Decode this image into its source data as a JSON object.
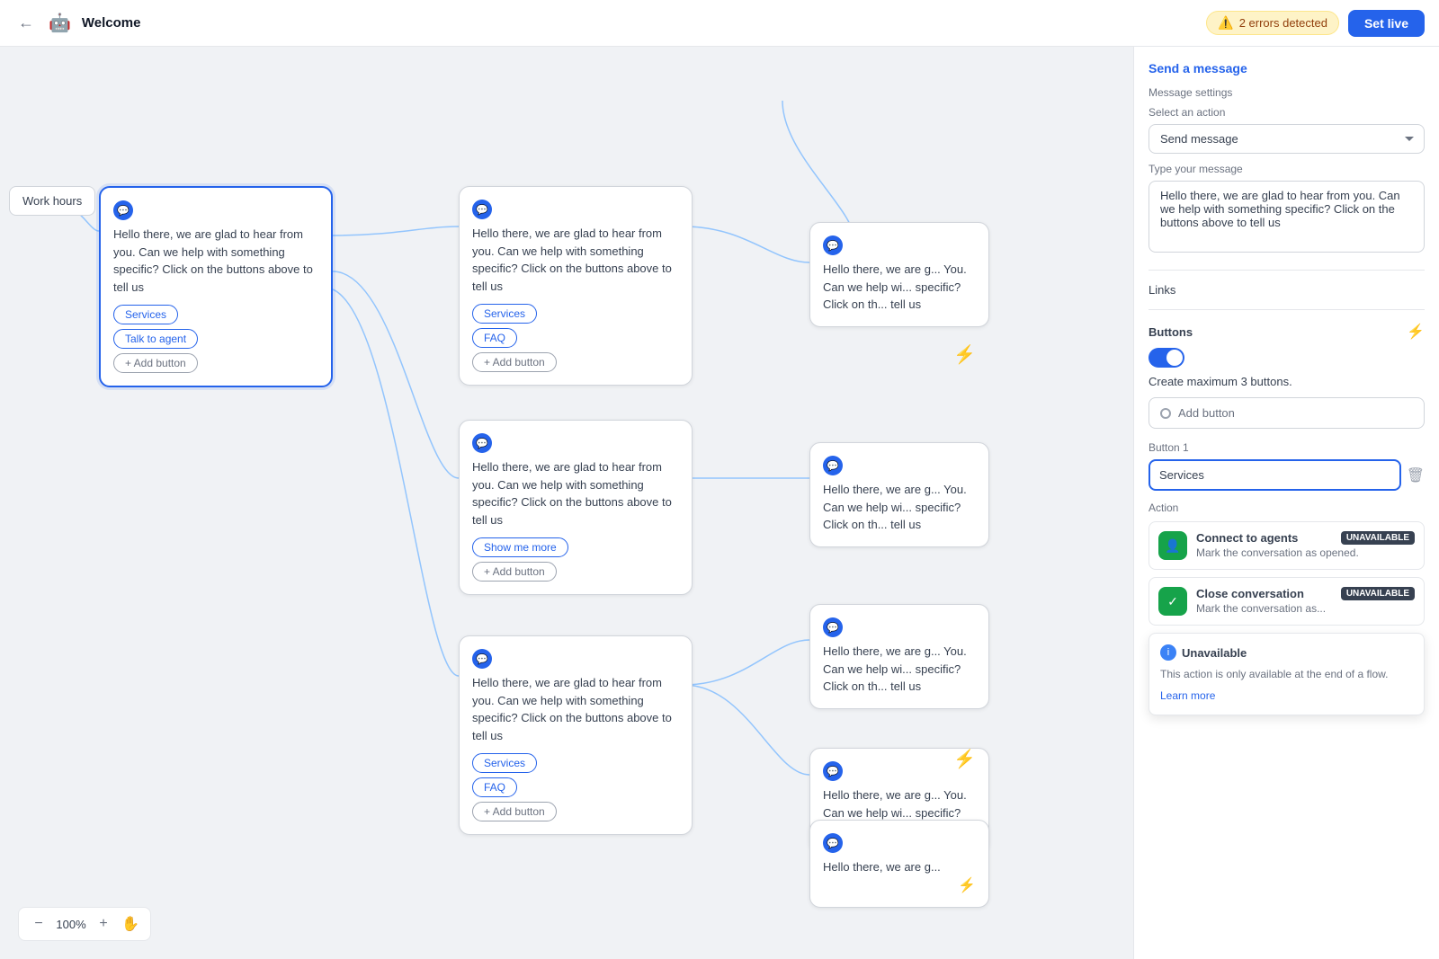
{
  "topbar": {
    "title": "Welcome",
    "app_icon": "🤖",
    "back_label": "←",
    "errors": {
      "label": "2 errors detected"
    },
    "set_live_label": "Set live"
  },
  "canvas": {
    "zoom": "100%",
    "zoom_minus": "−",
    "zoom_plus": "+"
  },
  "nodes": {
    "work_hours": "Work hours",
    "message_text": "Hello there, we are glad to hear from you. Can we help with something specific? Click on the buttons above to tell us",
    "button_services": "Services",
    "button_talk_agent": "Talk to agent",
    "button_faq": "FAQ",
    "button_show_more": "Show me more",
    "add_button_label": "+ Add button"
  },
  "right_panel": {
    "send_message": "Send a message",
    "message_settings": "Message settings",
    "select_action_label": "Select an action",
    "select_action_value": "Send message",
    "type_message_label": "Type your message",
    "message_value": "Hello there, we are glad to hear from you. Can we help with something specific? Click on the buttons above to tell us",
    "links_label": "Links",
    "buttons_section": {
      "label": "Buttons",
      "create_max_text": "Create maximum 3 buttons.",
      "add_button_label": "Add button",
      "button1_label": "Button 1",
      "button1_value": "Services"
    },
    "action_label": "Action",
    "actions": [
      {
        "title": "Connect to agents",
        "desc": "Mark the conversation as opened.",
        "badge": "UNAVAILABLE",
        "icon": "👤"
      },
      {
        "title": "Close conversation",
        "desc": "Mark the conversation as...",
        "badge": "UNAVAILABLE",
        "icon": "✓"
      }
    ],
    "tooltip": {
      "title": "Unavailable",
      "text": "This action is only available at the end of a flow.",
      "learn_more": "Learn more"
    }
  }
}
